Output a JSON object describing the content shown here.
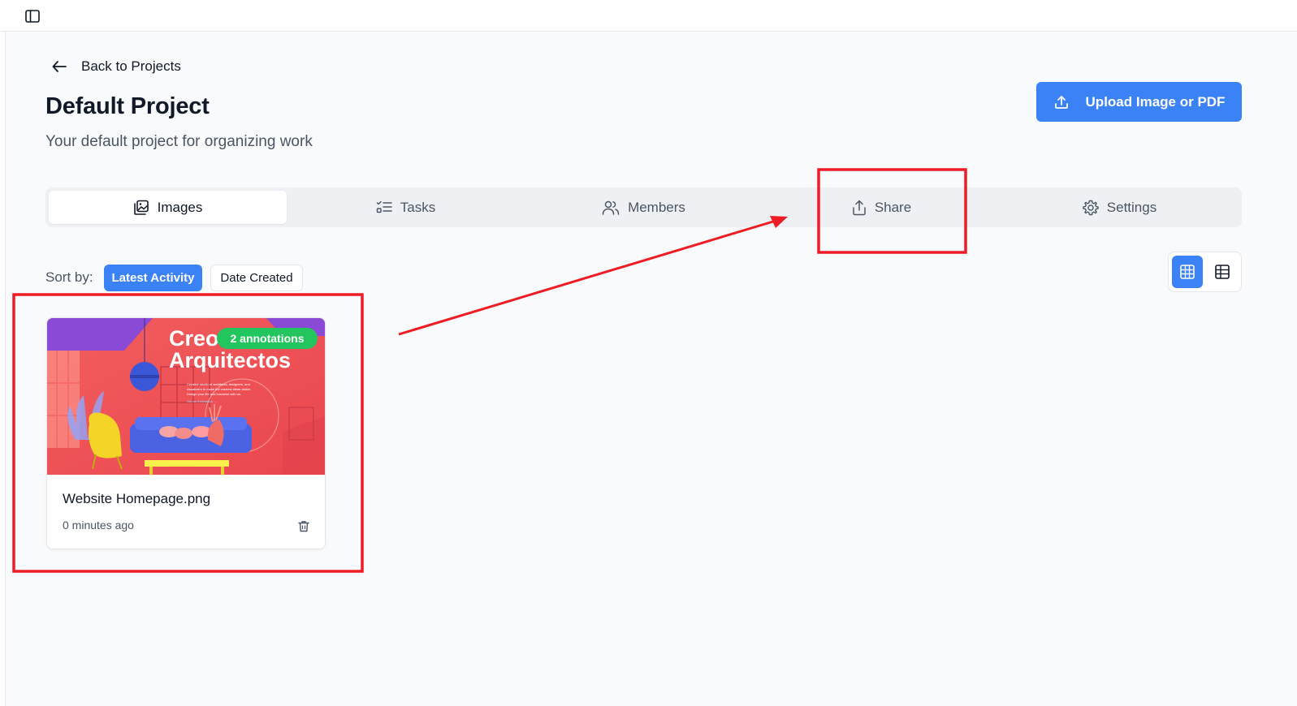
{
  "topbar": {
    "sidebar_toggle_icon": "panel-left-icon"
  },
  "header": {
    "back_label": "Back to Projects",
    "title": "Default Project",
    "subtitle": "Your default project for organizing work",
    "upload_label": "Upload Image or PDF"
  },
  "tabs": [
    {
      "label": "Images",
      "icon": "images-icon",
      "active": true
    },
    {
      "label": "Tasks",
      "icon": "list-checks-icon",
      "active": false
    },
    {
      "label": "Members",
      "icon": "users-icon",
      "active": false
    },
    {
      "label": "Share",
      "icon": "share-icon",
      "active": false
    },
    {
      "label": "Settings",
      "icon": "gear-icon",
      "active": false
    }
  ],
  "sort": {
    "label": "Sort by:",
    "options": [
      "Latest Activity",
      "Date Created"
    ],
    "selected": "Latest Activity"
  },
  "view_mode": {
    "selected": "grid",
    "options": [
      "grid",
      "table"
    ]
  },
  "images": [
    {
      "title": "Website Homepage.png",
      "time": "0 minutes ago",
      "annotations": "2 annotations",
      "thumbnail": {
        "heading_line1": "Creo",
        "heading_line2": "Arquitectos",
        "body_line1": "Creative studio of architects, designers, and",
        "body_line2": "visualizers to make the craziest ideas visible.",
        "body_line3": "Design your life and business with us.",
        "cta": "Get an Estimation →"
      }
    }
  ],
  "colors": {
    "primary": "#3b82f6",
    "badge": "#22c55e",
    "annotation": "#ee1c25",
    "background": "#f9fafb"
  }
}
